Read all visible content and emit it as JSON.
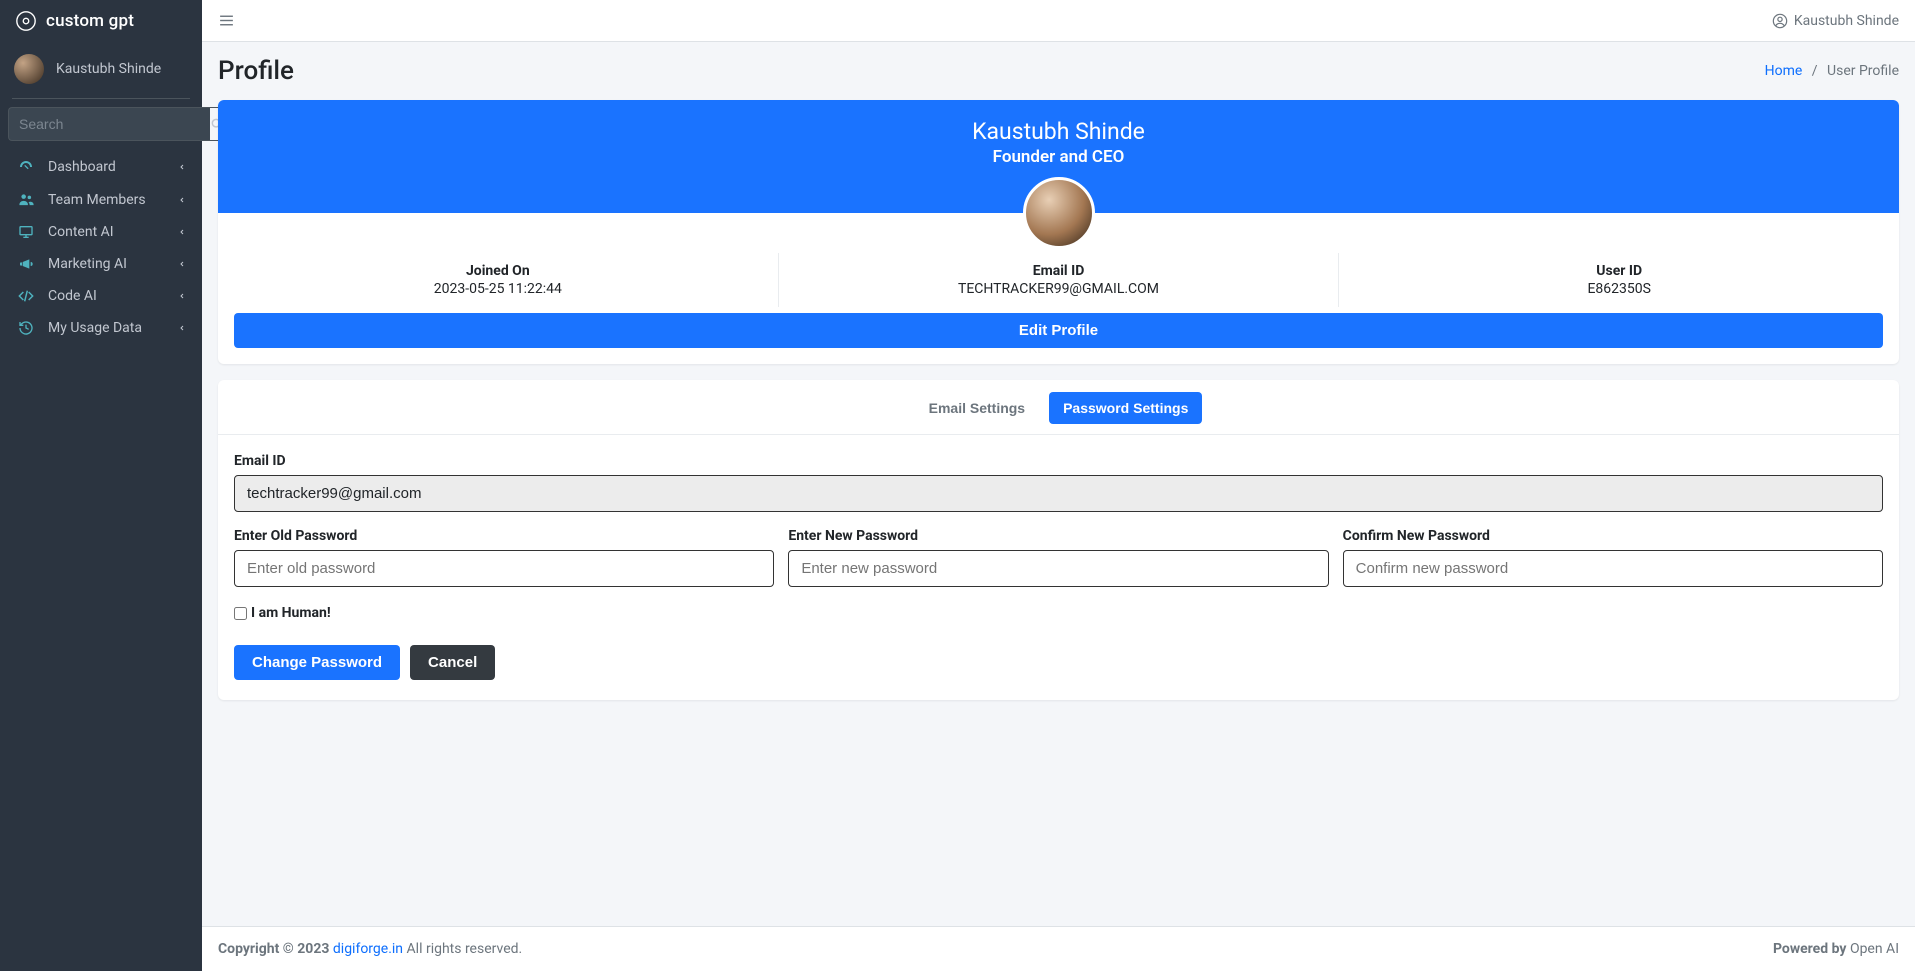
{
  "brand": {
    "text": "custom gpt"
  },
  "sidebar": {
    "user_name": "Kaustubh Shinde",
    "search_placeholder": "Search",
    "items": [
      {
        "label": "Dashboard"
      },
      {
        "label": "Team Members"
      },
      {
        "label": "Content AI"
      },
      {
        "label": "Marketing AI"
      },
      {
        "label": "Code AI"
      },
      {
        "label": "My Usage Data"
      }
    ]
  },
  "topbar": {
    "user_name": "Kaustubh Shinde"
  },
  "page": {
    "title": "Profile"
  },
  "breadcrumb": {
    "home": "Home",
    "current": "User Profile"
  },
  "profile": {
    "name": "Kaustubh Shinde",
    "role": "Founder and CEO",
    "stats": {
      "joined_label": "Joined On",
      "joined_value": "2023-05-25 11:22:44",
      "email_label": "Email ID",
      "email_value": "TECHTRACKER99@GMAIL.COM",
      "userid_label": "User ID",
      "userid_value": "E862350S"
    },
    "edit_button": "Edit Profile"
  },
  "tabs": {
    "email": "Email Settings",
    "password": "Password Settings"
  },
  "form": {
    "email_label": "Email ID",
    "email_value": "techtracker99@gmail.com",
    "old_pw_label": "Enter Old Password",
    "old_pw_placeholder": "Enter old password",
    "new_pw_label": "Enter New Password",
    "new_pw_placeholder": "Enter new password",
    "confirm_pw_label": "Confirm New Password",
    "confirm_pw_placeholder": "Confirm new password",
    "human_label": "I am Human!",
    "submit": "Change Password",
    "cancel": "Cancel"
  },
  "footer": {
    "copyright_prefix": "Copyright © 2023 ",
    "site_link": "digiforge.in",
    "rights": " All rights reserved.",
    "powered_prefix": "Powered by ",
    "powered_by": "Open AI"
  }
}
